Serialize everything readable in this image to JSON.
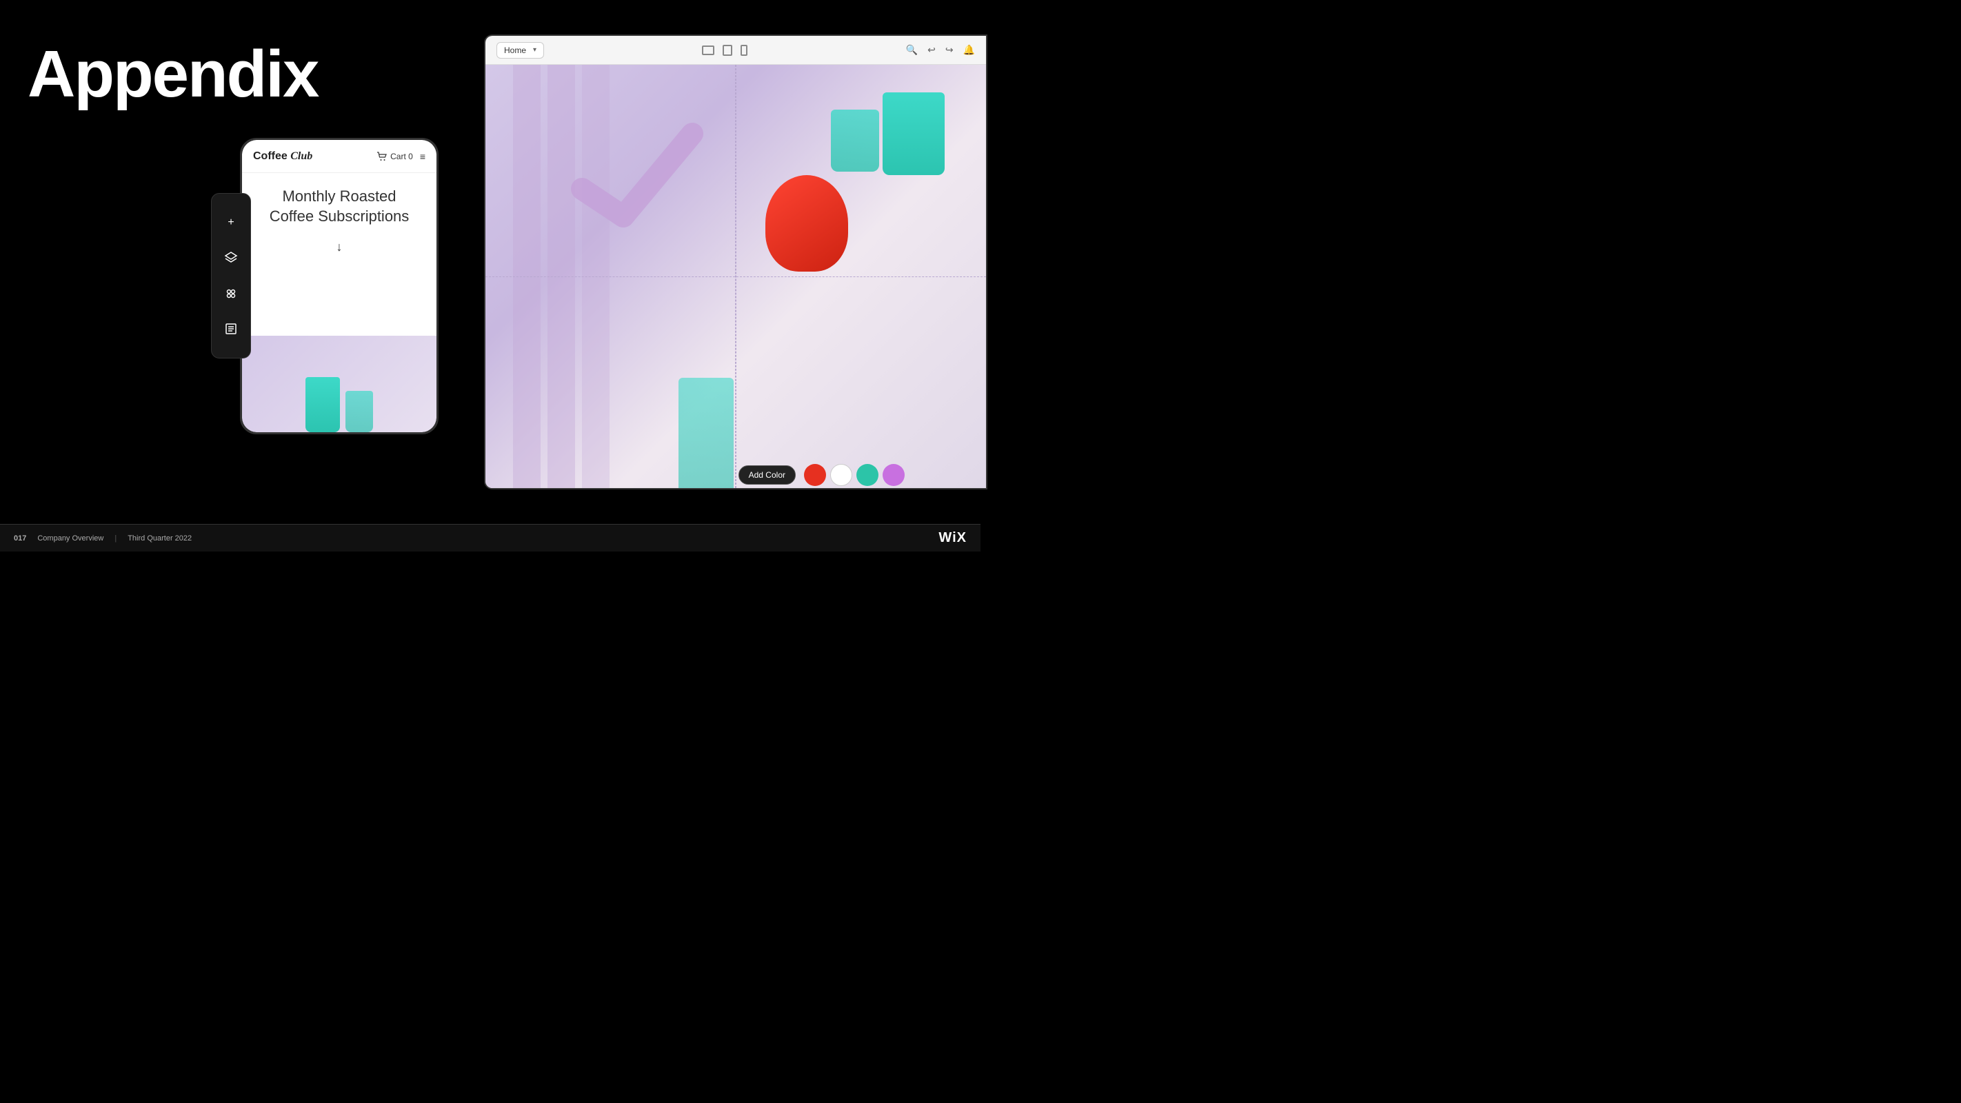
{
  "page": {
    "title": "Appendix",
    "background": "#000000"
  },
  "bottom_bar": {
    "page_number": "017",
    "company": "Company Overview",
    "separator": "|",
    "quarter": "Third Quarter 2022",
    "brand": "WiX"
  },
  "editor": {
    "toolbar": {
      "nav_label": "Home",
      "nav_arrow": "▾",
      "device_icons": [
        "desktop",
        "tablet",
        "phone"
      ],
      "right_icons": [
        "zoom",
        "undo",
        "redo",
        "bell"
      ]
    }
  },
  "mobile_preview": {
    "logo_text": "Coffee",
    "logo_italic": "Club",
    "cart_label": "Cart 0",
    "menu_icon": "≡",
    "title_line1": "Monthly Roasted",
    "title_line2": "Coffee Subscriptions",
    "arrow": "↓"
  },
  "sidebar_tools": [
    {
      "icon": "+",
      "name": "add"
    },
    {
      "icon": "⬡",
      "name": "layers"
    },
    {
      "icon": "✦",
      "name": "apps"
    },
    {
      "icon": "☰",
      "name": "pages"
    }
  ],
  "color_picker": {
    "add_label": "Add Color",
    "swatches": [
      {
        "color": "#e63020",
        "name": "red"
      },
      {
        "color": "#ffffff",
        "name": "white"
      },
      {
        "color": "#2cc4a8",
        "name": "teal"
      },
      {
        "color": "#c870e0",
        "name": "purple"
      }
    ]
  }
}
